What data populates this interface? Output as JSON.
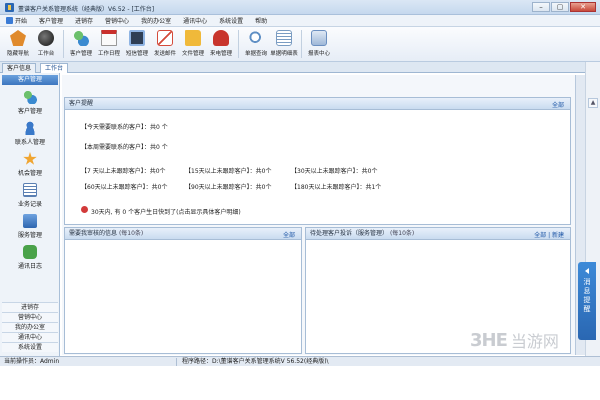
{
  "window": {
    "title": "董谱客户关系管理系统（经典版）V6.52 - [工作台]",
    "buttons": [
      "–",
      "▢",
      "✕"
    ]
  },
  "menu": {
    "start": "开始",
    "items": [
      "客户管理",
      "进销存",
      "营销中心",
      "我的办公室",
      "通讯中心",
      "系统设置",
      "帮助"
    ]
  },
  "toolbar": {
    "groups": [
      [
        {
          "label": "隐藏导航",
          "icon": "hide-nav-icon",
          "color": "#e08a2c"
        },
        {
          "label": "工作台",
          "icon": "workbench-icon",
          "color": "#3a3a3a"
        }
      ],
      [
        {
          "label": "客户管理",
          "icon": "customer-icon",
          "color": "#4b9e4b"
        },
        {
          "label": "工作日程",
          "icon": "calendar-icon",
          "color": "#d9d9d9"
        },
        {
          "label": "短信管理",
          "icon": "sms-icon",
          "color": "#3f7fcf"
        },
        {
          "label": "发送邮件",
          "icon": "email-icon",
          "color": "#d44b3b"
        },
        {
          "label": "文件管理",
          "icon": "folder-icon",
          "color": "#f0b93a"
        },
        {
          "label": "来电管理",
          "icon": "phone-icon",
          "color": "#c8352d"
        }
      ],
      [
        {
          "label": "单据查询",
          "icon": "doc-search-icon",
          "color": "#5f8fc4"
        },
        {
          "label": "单据明细表",
          "icon": "doc-detail-icon",
          "color": "#7a9cc2"
        }
      ],
      [
        {
          "label": "报表中心",
          "icon": "report-icon",
          "color": "#6b8fc0"
        }
      ]
    ]
  },
  "tabs": [
    {
      "label": "客户信息"
    },
    {
      "label": "工作台"
    }
  ],
  "leftnav": {
    "header": "客户管理",
    "items": [
      {
        "label": "客户管理",
        "icon": "customer-icon",
        "color": "#4b9e4b"
      },
      {
        "label": "联系人管理",
        "icon": "contact-icon",
        "color": "#3a79c9"
      },
      {
        "label": "机会管理",
        "icon": "star-icon",
        "color": "#f0a531"
      },
      {
        "label": "业务记录",
        "icon": "record-icon",
        "color": "#5a7fb3"
      },
      {
        "label": "服务管理",
        "icon": "service-icon",
        "color": "#3e7cc6"
      },
      {
        "label": "通讯日志",
        "icon": "chat-icon",
        "color": "#4aa24a"
      }
    ],
    "sections": [
      "进销存",
      "营销中心",
      "我的办公室",
      "通讯中心",
      "系统设置"
    ]
  },
  "panels": {
    "reminder": {
      "title": "客户提醒",
      "link": "全部",
      "today": "【今天需要联系的客户】：共0 个",
      "week": "【本周需要联系的客户】：共0 个",
      "row1": [
        "【7 天以上未跟踪客户】：共0个",
        "【15天以上未跟踪客户】：共0个",
        "【30天以上未跟踪客户】：共0个"
      ],
      "row2": [
        "【60天以上未跟踪客户】：共0个",
        "【90天以上未跟踪客户】：共0个",
        "【180天以上未跟踪客户】：共1个"
      ],
      "birthday": "30天内, 有 0 个客户生日快到了(点击显示具体客户明细)"
    },
    "approval": {
      "title": "需要我审核的信息",
      "sub": "(每10条)",
      "link": "全部"
    },
    "service": {
      "title": "待处理客户投诉（服务管理）",
      "sub": "(每10条)",
      "link": "全部 | 新建"
    }
  },
  "side_tab": {
    "label": "消息提醒"
  },
  "status": {
    "user": "当前操作员：Admin",
    "path": "程序路径：D:\\董谱客户关系管理系统V 56.52(经典版)\\"
  },
  "watermark": {
    "logo": "3HE",
    "text": "当游网"
  }
}
